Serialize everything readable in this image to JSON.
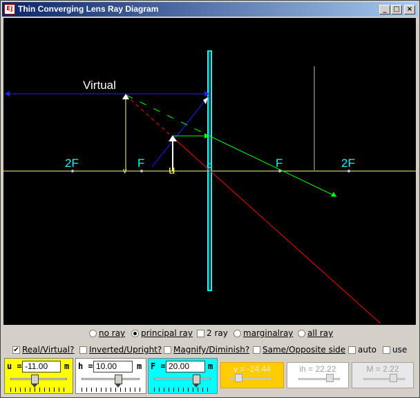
{
  "window": {
    "title": "Thin Converging Lens Ray Diagram",
    "icon_text": "Ej",
    "min_glyph": "_",
    "max_glyph": "□",
    "close_glyph": "×"
  },
  "diagram": {
    "labels": {
      "virtual": "Virtual",
      "twoF_left": "2F",
      "F_left": "F",
      "F_right": "F",
      "twoF_right": "2F",
      "u_marker": "u",
      "v_marker": "v"
    },
    "colors": {
      "background": "#000000",
      "axis": "#ffff80",
      "lens": "#00ffff",
      "focal_labels": "#00ffff",
      "ray_blue": "#2020ff",
      "ray_green": "#00ff00",
      "ray_red": "#ff0000",
      "object": "#ffffff",
      "image": "#ffff80",
      "virtual_label": "#ffffff"
    }
  },
  "ray_options": {
    "selected": "principal ray",
    "items": [
      {
        "label": "no ray",
        "type": "radio",
        "checked": false
      },
      {
        "label": "principal ray",
        "type": "radio",
        "checked": true
      },
      {
        "label": "2 ray",
        "type": "checkbox",
        "checked": false
      },
      {
        "label": "marginalray",
        "type": "radio",
        "checked": false
      },
      {
        "label": "all ray",
        "type": "radio",
        "checked": false
      }
    ]
  },
  "checks": [
    {
      "label": "Real/Virtual?",
      "checked": true,
      "mark": "✔"
    },
    {
      "label": "Inverted/Upright?",
      "checked": false
    },
    {
      "label": "Magnify/Diminish?",
      "checked": false
    },
    {
      "label": "Same/Opposite side",
      "checked": false
    },
    {
      "label": "auto",
      "checked": false
    },
    {
      "label": "use",
      "checked": false
    }
  ],
  "inputs": {
    "u": {
      "label": "u =",
      "value": "-11.00",
      "unit": "m",
      "color": "#ffff00"
    },
    "h": {
      "label": "h =",
      "value": "10.00",
      "unit": "m",
      "color": "#ffffff"
    },
    "F": {
      "label": "F =",
      "value": "20.00",
      "unit": "m",
      "color": "#00ffff"
    }
  },
  "outputs": {
    "v": {
      "text": "v = -24.44",
      "color": "#ffcc00"
    },
    "ih": {
      "text": "ih = 22.22"
    },
    "M": {
      "text": "M = 2.22"
    }
  }
}
